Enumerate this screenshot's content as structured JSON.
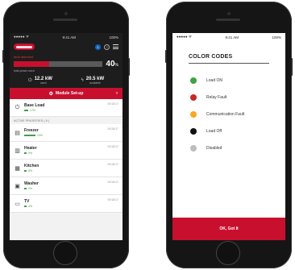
{
  "left_phone": {
    "status": {
      "carrier": "●●●●● ᯤ",
      "time": "9:41 AM",
      "battery": "100%"
    },
    "header": {
      "badge": "1",
      "help": "?"
    },
    "power": {
      "fault_label": "fault detected",
      "percent": "40",
      "percent_unit": "%",
      "fill_percent": 40,
      "total_label": "total power used",
      "used_value": "12.2 kW",
      "used_label": "used",
      "available_value": "20.5 kW",
      "available_label": "available"
    },
    "module_button": "Module Set-up",
    "base_load": {
      "name": "Base Load",
      "percent": "17%",
      "date": "09/18/17"
    },
    "section_title": "ACTIVE PRIORITIES ( 8 )",
    "priorities": [
      {
        "name": "Freezer",
        "percent": "10%",
        "date": "09/18/17",
        "bar": 14,
        "icon": "freezer-icon",
        "glyph": "▤"
      },
      {
        "name": "Heater",
        "percent": "9%",
        "date": "09/18/17",
        "bar": 3,
        "icon": "heater-icon",
        "glyph": "▥"
      },
      {
        "name": "Kitchen",
        "percent": "8%",
        "date": "09/18/17",
        "bar": 3,
        "icon": "kitchen-icon",
        "glyph": "▦"
      },
      {
        "name": "Washer",
        "percent": "4%",
        "date": "09/18/17",
        "bar": 3,
        "icon": "washer-icon",
        "glyph": "▣"
      },
      {
        "name": "TV",
        "percent": "4%",
        "date": "09/18/17",
        "bar": 3,
        "icon": "tv-icon",
        "glyph": "▭"
      }
    ]
  },
  "right_phone": {
    "status": {
      "carrier": "●●●●● ᯤ",
      "time": "9:41 AM",
      "battery": "100%"
    },
    "title": "COLOR CODES",
    "codes": [
      {
        "label": "Load ON",
        "color": "#43a047"
      },
      {
        "label": "Relay Fault",
        "color": "#c62828"
      },
      {
        "label": "Communication Fault",
        "color": "#f9a825"
      },
      {
        "label": "Load Off",
        "color": "#111111"
      },
      {
        "label": "Disabled",
        "color": "#bdbdbd"
      }
    ],
    "ok_button": "OK, Got It"
  },
  "colors": {
    "brand": "#c8102e",
    "dark": "#1d1d1d",
    "green": "#43a047"
  }
}
